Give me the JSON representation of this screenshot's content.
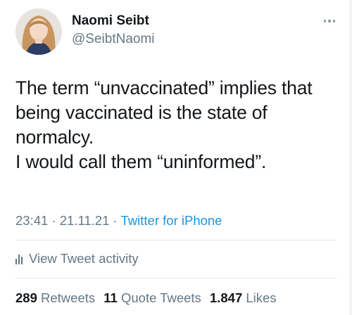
{
  "author": {
    "name": "Naomi Seibt",
    "handle": "@SeibtNaomi"
  },
  "tweet": {
    "lines": [
      "The term “unvaccinated” implies that",
      "being vaccinated is the state of",
      "normalcy.",
      "I would call them “uninformed”."
    ],
    "time": "23:41",
    "date": "21.11.21",
    "separator": "·",
    "source": "Twitter for iPhone"
  },
  "activity": {
    "label": "View Tweet activity",
    "icon": "bar-chart-icon"
  },
  "stats": {
    "retweets_count": "289",
    "retweets_label": "Retweets",
    "quote_count": "11",
    "quote_label": "Quote Tweets",
    "likes_count": "1.847",
    "likes_label": "Likes"
  },
  "colors": {
    "text": "#14171a",
    "secondary": "#657786",
    "link": "#1b95e0",
    "divider": "#e1e8ed"
  }
}
